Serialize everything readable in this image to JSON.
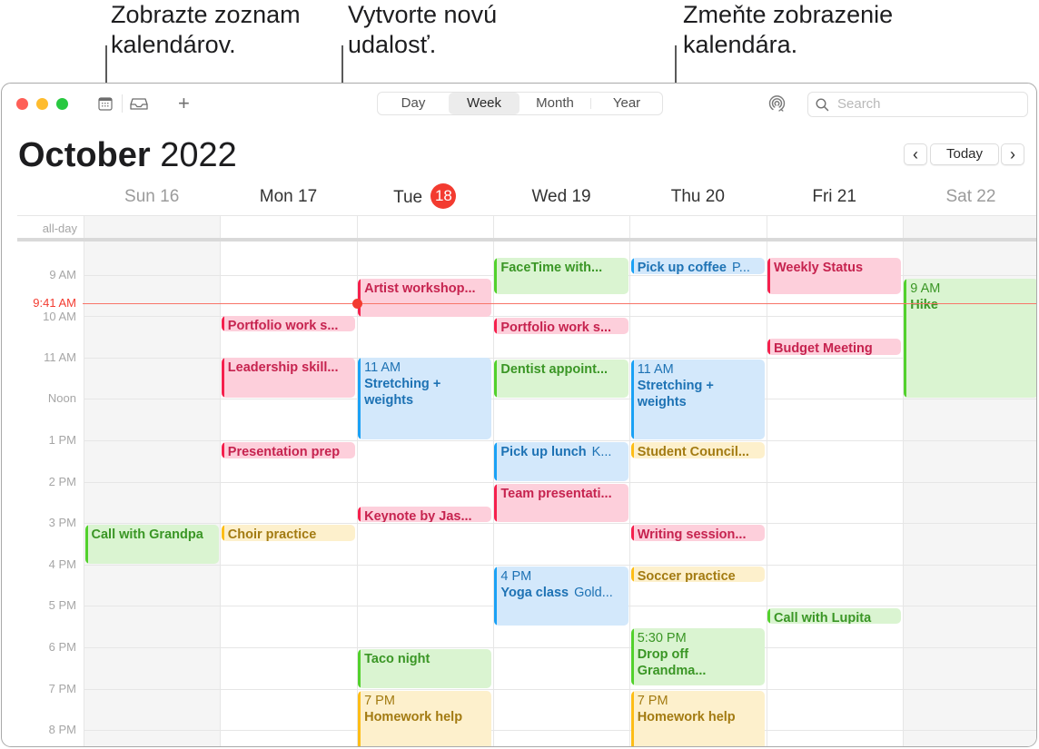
{
  "callouts": [
    {
      "line1": "Zobrazte zoznam",
      "line2": "kalendárov."
    },
    {
      "line1": "Vytvorte novú",
      "line2": "udalosť."
    },
    {
      "line1": "Zmeňte zobrazenie",
      "line2": "kalendára."
    }
  ],
  "toolbar": {
    "calendars_icon": "calendar-list-icon",
    "inbox_icon": "inbox-tray-icon",
    "add_icon": "plus-icon",
    "add_label": "+",
    "views": [
      {
        "label": "Day",
        "active": false
      },
      {
        "label": "Week",
        "active": true
      },
      {
        "label": "Month",
        "active": false
      },
      {
        "label": "Year",
        "active": false
      }
    ],
    "airdrop_icon": "airdrop-icon",
    "search": {
      "placeholder": "Search",
      "value": ""
    }
  },
  "header": {
    "month": "October",
    "year": "2022",
    "prev_label": "‹",
    "today_label": "Today",
    "next_label": "›"
  },
  "days": [
    {
      "name": "Sun",
      "num": "16",
      "weekend": true,
      "today": false
    },
    {
      "name": "Mon",
      "num": "17",
      "weekend": false,
      "today": false
    },
    {
      "name": "Tue",
      "num": "18",
      "weekend": false,
      "today": true
    },
    {
      "name": "Wed",
      "num": "19",
      "weekend": false,
      "today": false
    },
    {
      "name": "Thu",
      "num": "20",
      "weekend": false,
      "today": false
    },
    {
      "name": "Fri",
      "num": "21",
      "weekend": false,
      "today": false
    },
    {
      "name": "Sat",
      "num": "22",
      "weekend": true,
      "today": false
    }
  ],
  "allday_label": "all-day",
  "hours": [
    {
      "h": 9,
      "label": "9 AM"
    },
    {
      "h": 10,
      "label": "10 AM"
    },
    {
      "h": 11,
      "label": "11 AM"
    },
    {
      "h": 12,
      "label": "Noon"
    },
    {
      "h": 13,
      "label": "1 PM"
    },
    {
      "h": 14,
      "label": "2 PM"
    },
    {
      "h": 15,
      "label": "3 PM"
    },
    {
      "h": 16,
      "label": "4 PM"
    },
    {
      "h": 17,
      "label": "5 PM"
    },
    {
      "h": 18,
      "label": "6 PM"
    },
    {
      "h": 19,
      "label": "7 PM"
    },
    {
      "h": 20,
      "label": "8 PM"
    }
  ],
  "now": {
    "label": "9:41 AM",
    "time": 9.683,
    "day": 2
  },
  "colors": {
    "red": "#f5204d",
    "green": "#52d12c",
    "blue": "#1aa1f5",
    "yellow": "#fdbd17",
    "today_badge": "#f33b30"
  },
  "events": [
    {
      "day": 0,
      "start": 15.05,
      "end": 16.0,
      "title": "Call with Grandpa",
      "color": "green"
    },
    {
      "day": 1,
      "start": 10.0,
      "end": 10.4,
      "title": "Portfolio work s...",
      "color": "red"
    },
    {
      "day": 1,
      "start": 11.0,
      "end": 12.0,
      "title": "Leadership skill...",
      "color": "red"
    },
    {
      "day": 1,
      "start": 13.05,
      "end": 13.45,
      "title": "Presentation prep",
      "color": "red"
    },
    {
      "day": 1,
      "start": 15.05,
      "end": 15.45,
      "title": "Choir practice",
      "color": "yellow"
    },
    {
      "day": 2,
      "start": 9.1,
      "end": 10.05,
      "title": "Artist workshop...",
      "color": "red"
    },
    {
      "day": 2,
      "start": 11.0,
      "end": 13.0,
      "time": "11 AM",
      "title": "Stretching + weights",
      "color": "blue",
      "wrap": true
    },
    {
      "day": 2,
      "start": 14.6,
      "end": 15.0,
      "title": "Keynote by Jas...",
      "color": "red"
    },
    {
      "day": 2,
      "start": 18.05,
      "end": 19.0,
      "title": "Taco night",
      "color": "green"
    },
    {
      "day": 2,
      "start": 19.05,
      "end": 20.5,
      "time": "7 PM",
      "title": "Homework help",
      "color": "yellow"
    },
    {
      "day": 3,
      "start": 8.6,
      "end": 9.5,
      "title": "FaceTime with...",
      "color": "green"
    },
    {
      "day": 3,
      "start": 10.05,
      "end": 10.45,
      "title": "Portfolio work s...",
      "color": "red"
    },
    {
      "day": 3,
      "start": 11.05,
      "end": 12.0,
      "title": "Dentist appoint...",
      "color": "green"
    },
    {
      "day": 3,
      "start": 13.05,
      "end": 14.0,
      "title": "Pick up lunch",
      "location": "K...",
      "color": "blue"
    },
    {
      "day": 3,
      "start": 14.05,
      "end": 15.0,
      "title": "Team presentati...",
      "color": "red"
    },
    {
      "day": 3,
      "start": 16.05,
      "end": 17.5,
      "time": "4 PM",
      "title": "Yoga class",
      "location": "Gold...",
      "color": "blue"
    },
    {
      "day": 4,
      "start": 8.6,
      "end": 9.0,
      "title": "Pick up coffee",
      "location": "P...",
      "color": "blue"
    },
    {
      "day": 4,
      "start": 11.05,
      "end": 13.0,
      "time": "11 AM",
      "title": "Stretching + weights",
      "color": "blue",
      "wrap": true
    },
    {
      "day": 4,
      "start": 13.05,
      "end": 13.45,
      "title": "Student Council...",
      "color": "yellow"
    },
    {
      "day": 4,
      "start": 15.05,
      "end": 15.45,
      "title": "Writing session...",
      "color": "red"
    },
    {
      "day": 4,
      "start": 16.05,
      "end": 16.45,
      "title": "Soccer practice",
      "color": "yellow"
    },
    {
      "day": 4,
      "start": 17.55,
      "end": 18.95,
      "time": "5:30 PM",
      "title": "Drop off Grandma...",
      "color": "green",
      "wrap": true
    },
    {
      "day": 4,
      "start": 19.05,
      "end": 20.5,
      "time": "7 PM",
      "title": "Homework help",
      "color": "yellow"
    },
    {
      "day": 5,
      "start": 8.6,
      "end": 9.5,
      "title": "Weekly Status",
      "color": "red"
    },
    {
      "day": 5,
      "start": 10.55,
      "end": 10.95,
      "title": "Budget Meeting",
      "color": "red"
    },
    {
      "day": 5,
      "start": 17.05,
      "end": 17.45,
      "title": "Call with Lupita",
      "color": "green"
    },
    {
      "day": 6,
      "start": 9.1,
      "end": 12.0,
      "time": "9 AM",
      "title": "Hike",
      "color": "green"
    }
  ]
}
